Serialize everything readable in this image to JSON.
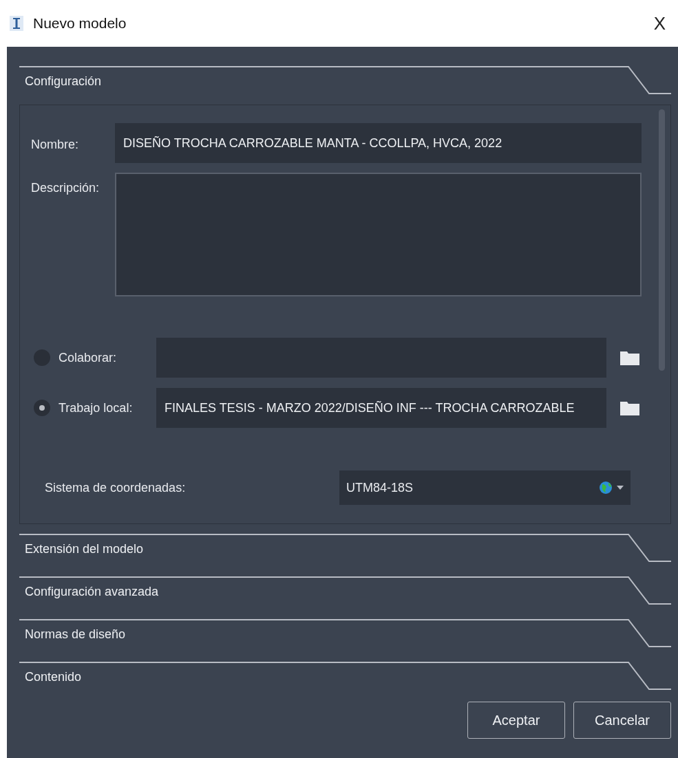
{
  "window": {
    "title": "Nuevo modelo",
    "close": "X"
  },
  "sections": [
    {
      "title": "Configuración"
    },
    {
      "title": "Extensión del modelo"
    },
    {
      "title": "Configuración avanzada"
    },
    {
      "title": "Normas de diseño"
    },
    {
      "title": "Contenido"
    }
  ],
  "config": {
    "name_label": "Nombre:",
    "name_value": "DISEÑO TROCHA CARROZABLE MANTA - CCOLLPA, HVCA, 2022",
    "description_label": "Descripción:",
    "locations": [
      {
        "label": "Colaborar:",
        "selected": false
      },
      {
        "label": "Trabajo local:",
        "value": "FINALES TESIS - MARZO 2022/DISEÑO INF --- TROCHA CARROZABLE",
        "selected": true
      }
    ],
    "coords_label": "Sistema de coordenadas:",
    "coords_value": "UTM84-18S"
  },
  "buttons": [
    "Aceptar",
    "Cancelar"
  ]
}
